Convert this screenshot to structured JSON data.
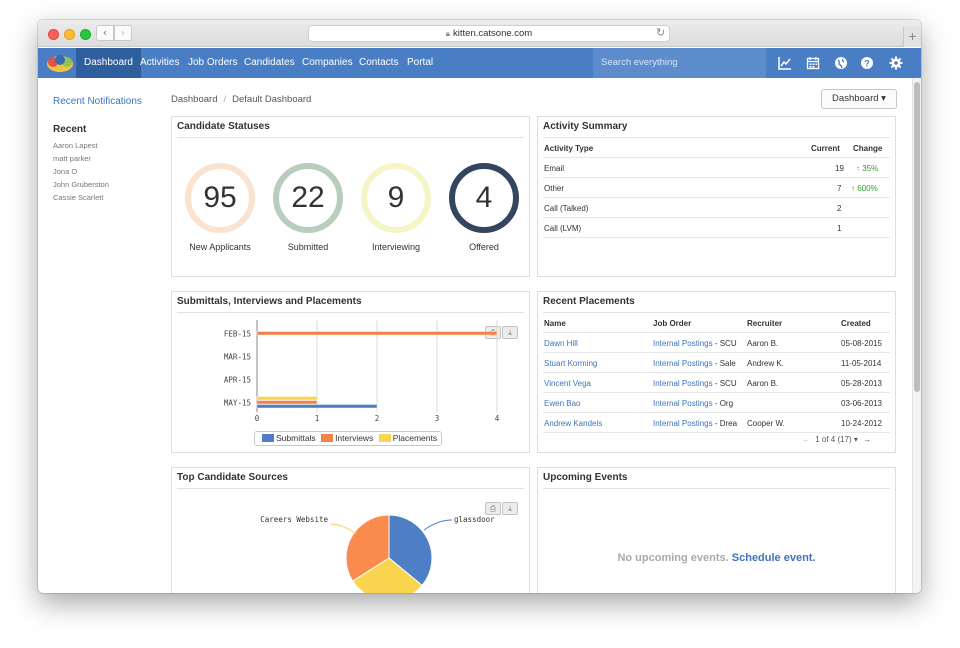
{
  "browser": {
    "url": "kitten.catsone.com"
  },
  "nav": {
    "items": [
      "Dashboard",
      "Activities",
      "Job Orders",
      "Candidates",
      "Companies",
      "Contacts",
      "Portal"
    ],
    "search_placeholder": "Search everything"
  },
  "sidebar": {
    "notifications_link": "Recent Notifications",
    "recent_title": "Recent",
    "recent_items": [
      "Aaron Lapest",
      "matt parker",
      "Jona O",
      "John Gruberston",
      "Cassie Scarlett"
    ]
  },
  "breadcrumb": {
    "root": "Dashboard",
    "current": "Default Dashboard"
  },
  "dashboard_button": "Dashboard ▾",
  "candidate_statuses": {
    "title": "Candidate Statuses",
    "items": [
      {
        "value": "95",
        "label": "New Applicants",
        "color": "#fbe3cf"
      },
      {
        "value": "22",
        "label": "Submitted",
        "color": "#b9cdbd"
      },
      {
        "value": "9",
        "label": "Interviewing",
        "color": "#f6f5c7"
      },
      {
        "value": "4",
        "label": "Offered",
        "color": "#34465f"
      }
    ]
  },
  "activity_summary": {
    "title": "Activity Summary",
    "headers": [
      "Activity Type",
      "Current",
      "Change"
    ],
    "rows": [
      {
        "type": "Email",
        "current": "19",
        "change": "↑ 35%"
      },
      {
        "type": "Other",
        "current": "7",
        "change": "↑ 600%"
      },
      {
        "type": "Call (Talked)",
        "current": "2",
        "change": ""
      },
      {
        "type": "Call (LVM)",
        "current": "1",
        "change": ""
      }
    ]
  },
  "submittals": {
    "title": "Submittals, Interviews and Placements"
  },
  "recent_placements": {
    "title": "Recent Placements",
    "headers": [
      "Name",
      "Job Order",
      "Recruiter",
      "Created"
    ],
    "rows": [
      {
        "name": "Dawn Hill",
        "job_link": "Internal Postings",
        "job_rest": " - SCU",
        "recruiter": "Aaron B.",
        "created": "05-08-2015"
      },
      {
        "name": "Stuart Korming",
        "job_link": "Internal Postings",
        "job_rest": " - Sale",
        "recruiter": "Andrew K.",
        "created": "11-05-2014"
      },
      {
        "name": "Vincent Vega",
        "job_link": "Internal Postings",
        "job_rest": " - SCU",
        "recruiter": "Aaron B.",
        "created": "05-28-2013"
      },
      {
        "name": "Ewen Bao",
        "job_link": "Internal Postings",
        "job_rest": " - Org",
        "recruiter": "",
        "created": "03-06-2013"
      },
      {
        "name": "Andrew Kandels",
        "job_link": "Internal Postings",
        "job_rest": " - Drea",
        "recruiter": "Cooper W.",
        "created": "10-24-2012"
      }
    ],
    "pagination": "1 of 4 (17) ▾"
  },
  "top_sources": {
    "title": "Top Candidate Sources"
  },
  "upcoming_events": {
    "title": "Upcoming Events",
    "empty_text": "No upcoming events.",
    "schedule_link": "Schedule event."
  },
  "chart_data": [
    {
      "type": "bar",
      "orientation": "horizontal",
      "categories": [
        "FEB-15",
        "MAR-15",
        "APR-15",
        "MAY-15"
      ],
      "series": [
        {
          "name": "Submittals",
          "values": [
            0,
            0,
            0,
            2
          ],
          "color": "#4e7fc6"
        },
        {
          "name": "Interviews",
          "values": [
            4,
            0,
            0,
            1
          ],
          "color": "#f2824a"
        },
        {
          "name": "Placements",
          "values": [
            0,
            0,
            0,
            1
          ],
          "color": "#f8d44f"
        }
      ],
      "xlim": [
        0,
        5
      ],
      "xticks": [
        "0",
        "1",
        "2",
        "3",
        "4",
        "5"
      ],
      "grid": true,
      "legend": "bottom"
    },
    {
      "type": "pie",
      "labels": [
        "glassdoor",
        "Careers Website",
        ""
      ],
      "values": [
        36,
        30,
        34
      ],
      "colors": [
        "#4e7fc6",
        "#f8d44f",
        "#f98b4e"
      ]
    }
  ]
}
